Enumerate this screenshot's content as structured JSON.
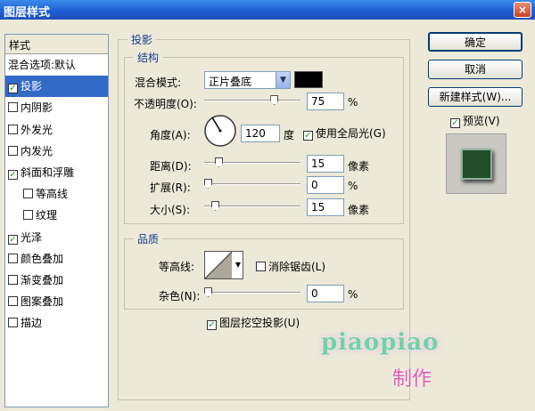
{
  "window": {
    "title": "图层样式",
    "close_glyph": "×"
  },
  "sidebar": {
    "header": "样式",
    "items": [
      {
        "label": "混合选项:默认",
        "check": ""
      },
      {
        "label": "投影",
        "check": "✓"
      },
      {
        "label": "内阴影",
        "check": ""
      },
      {
        "label": "外发光",
        "check": ""
      },
      {
        "label": "内发光",
        "check": ""
      },
      {
        "label": "斜面和浮雕",
        "check": "✓"
      },
      {
        "label": "等高线",
        "check": ""
      },
      {
        "label": "纹理",
        "check": ""
      },
      {
        "label": "光泽",
        "check": "✓"
      },
      {
        "label": "颜色叠加",
        "check": ""
      },
      {
        "label": "渐变叠加",
        "check": ""
      },
      {
        "label": "图案叠加",
        "check": ""
      },
      {
        "label": "描边",
        "check": ""
      }
    ]
  },
  "shadow_panel": {
    "title": "投影",
    "structure": {
      "title": "结构",
      "blend_mode_label": "混合模式:",
      "blend_mode_value": "正片叠底",
      "opacity_label": "不透明度(O):",
      "opacity_value": "75",
      "opacity_unit": "%",
      "opacity_level": 75,
      "angle_label": "角度(A):",
      "angle_value": "120",
      "angle_unit": "度",
      "global_light_label": "使用全局光(G)",
      "global_light_check": "✓",
      "distance_label": "距离(D):",
      "distance_value": "15",
      "distance_unit": "像素",
      "spread_label": "扩展(R):",
      "spread_value": "0",
      "spread_unit": "%",
      "size_label": "大小(S):",
      "size_value": "15",
      "size_unit": "像素"
    },
    "quality": {
      "title": "品质",
      "contour_label": "等高线:",
      "anti_alias_label": "消除锯齿(L)",
      "noise_label": "杂色(N):",
      "noise_value": "0",
      "noise_unit": "%"
    },
    "knockout_label": "图层挖空投影(U)",
    "knockout_check": "✓"
  },
  "buttons": {
    "ok": "确定",
    "cancel": "取消",
    "new_style": "新建样式(W)...",
    "preview_label": "预览(V)",
    "preview_check": "✓"
  },
  "watermark": {
    "text": "piaopiao",
    "sub": "制作"
  },
  "colors": {
    "shadow_color": "#000000",
    "selection": "#316AC5"
  }
}
